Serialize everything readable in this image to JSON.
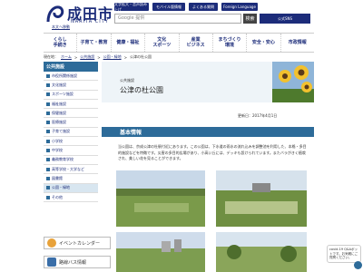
{
  "header": {
    "logo_text": "成田市",
    "logo_sub": "NARITA CITY",
    "skip_link": "本文へ移動",
    "buttons": [
      "文字拡大・音声読み上げ",
      "モバイル版情報",
      "よくある質問",
      "Foreign Language"
    ],
    "search_placeholder": "Google 提供",
    "search_label": "検索",
    "sns_label": "公式SNS"
  },
  "nav": {
    "items": [
      "くらし\n手続き",
      "子育て・教育",
      "健康・福祉",
      "文化\nスポーツ",
      "産業\nビジネス",
      "まちづくり\n環境",
      "安全・安心",
      "市政情報"
    ]
  },
  "breadcrumb": {
    "prefix": "現在地：",
    "items": [
      "ホーム",
      "公共施設",
      "公園・緑地",
      "公津の杜公園"
    ]
  },
  "sidebar": {
    "heading": "公共施設",
    "items": [
      "市役所関係施設",
      "文化施設",
      "スポーツ施設",
      "福祉施設",
      "保健施設",
      "医療施設",
      "子育て施設",
      "小学校",
      "中学校",
      "義務教育学校",
      "高等学校・大学など",
      "図書館",
      "公園・緑地",
      "その他"
    ],
    "active_index": 12,
    "banners": [
      "イベントカレンダー",
      "路線バス情報"
    ]
  },
  "main": {
    "category": "公共施設",
    "title": "公津の杜公園",
    "updated": "更新日：2017年4月1日",
    "section_heading": "基本情報",
    "body": "当公園は、京成公津の杜駅付近にあります。この公園は、下水道の雨水の流れ込みを調整池を利用した、本格・多目的施設などを特徴です。災害の多目的広場があり、小高い丘には、デッキも設けられています。またバラがきく植栽され、美しい花を見ることができます。"
  },
  "chat": {
    "text": "covid-19 Q&Aボットです。お気軽にご質問ください。"
  },
  "colors": {
    "brand": "#1c2c7a",
    "accent": "#2d6b99",
    "title_bg": "#eef4f8"
  }
}
